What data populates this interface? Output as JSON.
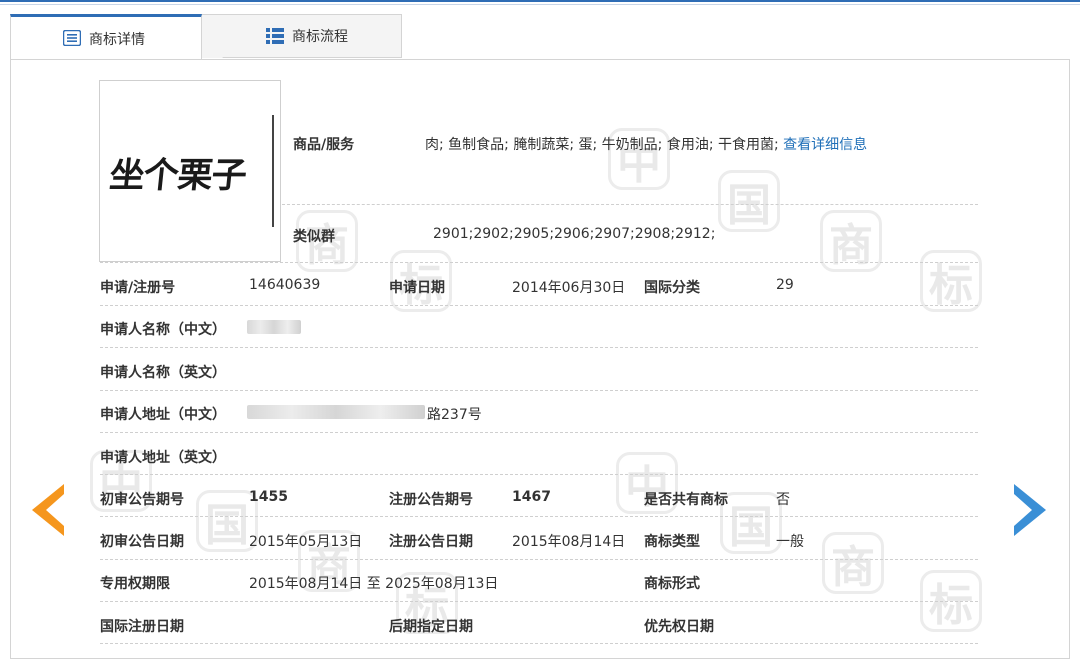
{
  "tabs": [
    {
      "label": "商标详情",
      "icon": "document-list-icon",
      "active": true
    },
    {
      "label": "商标流程",
      "icon": "list-bars-icon",
      "active": false
    }
  ],
  "colors": {
    "accent": "#2f6db5",
    "link": "#1f6fb8",
    "prev_arrow": "#f5961d",
    "next_arrow": "#3a8fd6"
  },
  "watermark_chars": [
    "中",
    "国",
    "商",
    "标"
  ],
  "trademark": {
    "logo_text": "坐个栗子",
    "goods_label": "商品/服务",
    "goods_value": "肉; 鱼制食品; 腌制蔬菜; 蛋; 牛奶制品; 食用油; 干食用菌;",
    "goods_link": "查看详细信息",
    "similar_label": "类似群",
    "similar_value": "2901;2902;2905;2906;2907;2908;2912;"
  },
  "details": {
    "reg_no_label": "申请/注册号",
    "reg_no": "14640639",
    "apply_date_label": "申请日期",
    "apply_date": "2014年06月30日",
    "intl_class_label": "国际分类",
    "intl_class": "29",
    "applicant_cn_label": "申请人名称（中文）",
    "applicant_en_label": "申请人名称（英文）",
    "address_cn_label": "申请人地址（中文）",
    "address_cn_suffix": "路237号",
    "address_en_label": "申请人地址（英文）",
    "prelim_issue_label": "初审公告期号",
    "prelim_issue": "1455",
    "reg_issue_label": "注册公告期号",
    "reg_issue": "1467",
    "shared_label": "是否共有商标",
    "shared": "否",
    "prelim_date_label": "初审公告日期",
    "prelim_date": "2015年05月13日",
    "reg_date_label": "注册公告日期",
    "reg_date": "2015年08月14日",
    "type_label": "商标类型",
    "type": "一般",
    "term_label": "专用权期限",
    "term": "2015年08月14日 至 2025年08月13日",
    "form_label": "商标形式",
    "intl_reg_date_label": "国际注册日期",
    "later_date_label": "后期指定日期",
    "priority_date_label": "优先权日期"
  },
  "nav": {
    "prev": "prev-arrow-icon",
    "next": "next-arrow-icon"
  }
}
